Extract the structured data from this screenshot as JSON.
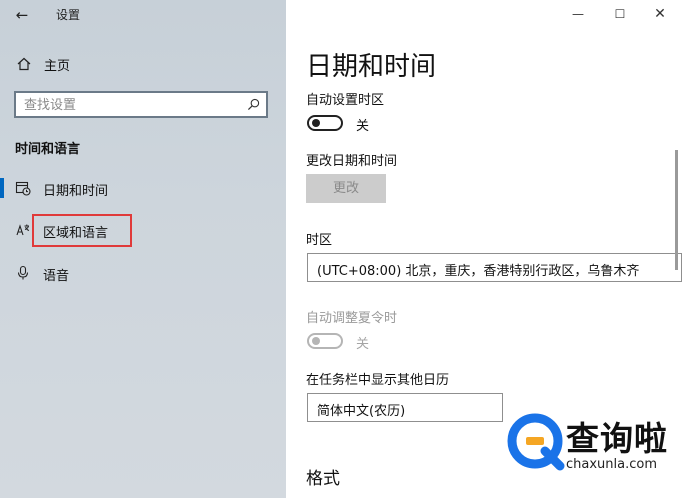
{
  "app": {
    "title": "设置"
  },
  "sidebar": {
    "home_label": "主页",
    "search_placeholder": "查找设置",
    "section_title": "时间和语言",
    "items": [
      {
        "label": "日期和时间",
        "icon": "calendar-clock-icon",
        "selected": true
      },
      {
        "label": "区域和语言",
        "icon": "region-language-icon",
        "selected": false
      },
      {
        "label": "语音",
        "icon": "microphone-icon",
        "selected": false
      }
    ]
  },
  "window_controls": {
    "minimize": "—",
    "maximize": "☐",
    "close": "✕"
  },
  "main": {
    "title": "日期和时间",
    "auto_timezone": {
      "label": "自动设置时区",
      "state": "关"
    },
    "change_datetime": {
      "label": "更改日期和时间",
      "button": "更改"
    },
    "timezone": {
      "label": "时区",
      "value": "(UTC+08:00) 北京，重庆，香港特别行政区，乌鲁木齐"
    },
    "dst": {
      "label": "自动调整夏令时",
      "state": "关"
    },
    "extra_calendar": {
      "label": "在任务栏中显示其他日历",
      "value": "简体中文(农历)"
    },
    "format_title": "格式"
  },
  "watermark": {
    "brand": "查询啦",
    "domain": "chaxunla.com",
    "accent": "#1a73e8",
    "accent2": "#f5a623"
  }
}
